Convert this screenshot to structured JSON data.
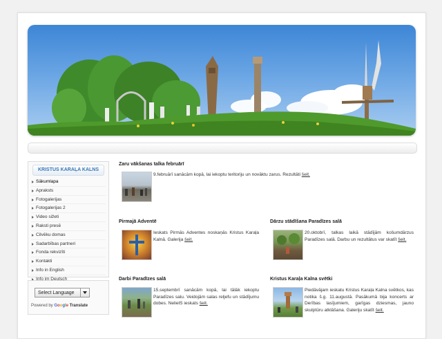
{
  "sidebar": {
    "title": "KRISTUS KARAĻA KALNS",
    "items": [
      "Sākumlapa",
      "Apraksts",
      "Fotogalerijas",
      "Fotogalerijas 2",
      "Video sižeti",
      "Raksti presē",
      "Cilvēku domas",
      "Sadarbības partneri",
      "Fonda rekvizīti",
      "Kontakti",
      "Info in English",
      "Info im Deutsch"
    ]
  },
  "translate": {
    "select_label": "Select Language",
    "powered_by": "Powered by",
    "google": "Google",
    "translate": "Translate"
  },
  "articles": {
    "a1": {
      "title": "Zaru vākšanas talka februārī",
      "text": "9.februārī sanācām kopā, lai iekoptu teritoriju un novāktu zarus. Rezultāti ",
      "link": "šeit."
    },
    "a2": {
      "title": "Pirmajā Adventē",
      "text": "Ieskats Pirmās Adventes noskaņās Kristus Karaļa Kalnā. Galerija ",
      "link": "šeit."
    },
    "a3": {
      "title": "Dārzu stādīšana Paradīzes salā",
      "text": "20.oktobrī, talkas laikā stādījām košumdārzus Paradīzes salā. Darbu un rezultātus var skatīt ",
      "link": "šeit."
    },
    "a4": {
      "title": "Darbi Paradīzes salā",
      "text": "15.septembrī sanācām kopā, lai tālāk iekoptu Paradīzes salu. Veidojām salas reljefu un stādījumu dobes. NelielS ieskats ",
      "link": "šeit."
    },
    "a5": {
      "title": "Kristus Karaļa Kalna svētki",
      "text": "Piedāvājam ieskatu Kristus Karaļa Kalna svētkos, kas notika š.g. 11.augustā. Pasākumā bija koncerts ar Derības lasījumiem, garīgas dziesmas, jauno skulptūru atklāšana. Galeriju skatīt ",
      "link": "šeit."
    }
  },
  "colors": {
    "sidebar_title": "#3a77b4",
    "sky_top": "#3d86d6",
    "grass": "#4f9a2c"
  }
}
